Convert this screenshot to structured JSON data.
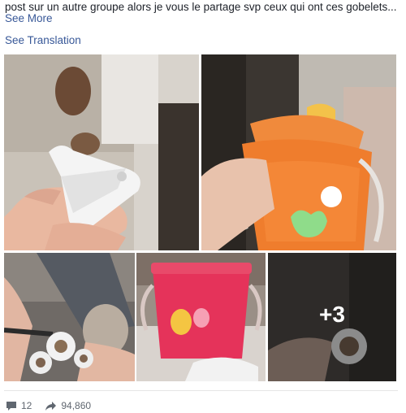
{
  "post": {
    "text": "post sur un autre groupe alors je vous le partage svp ceux qui ont ces gobelets...",
    "see_more": "See More",
    "see_translation": "See Translation"
  },
  "photos": {
    "more_count": "+3"
  },
  "footer": {
    "comments": "12",
    "shares": "94,860"
  },
  "colors": {
    "link": "#385898",
    "text": "#1d2129",
    "meta": "#606770"
  }
}
